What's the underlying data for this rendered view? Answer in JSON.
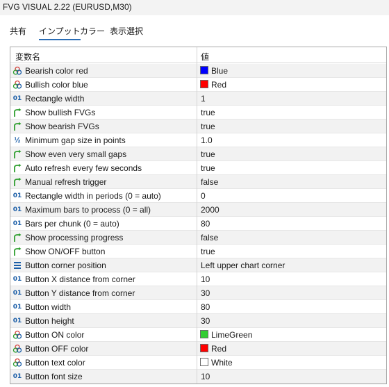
{
  "window": {
    "title": "FVG VISUAL 2.22 (EURUSD,M30)"
  },
  "tabs": [
    {
      "label": "共有",
      "active": false
    },
    {
      "label": "インプット",
      "active": true
    },
    {
      "label": "カラー",
      "active": false
    },
    {
      "label": "表示選択",
      "active": false
    }
  ],
  "table": {
    "header": {
      "name": "変数名",
      "value": "値"
    },
    "rows": [
      {
        "icon": "color-icon",
        "name": "Bearish color red",
        "value": "Blue",
        "swatch": "#0000ff"
      },
      {
        "icon": "color-icon",
        "name": "Bullish color blue",
        "value": "Red",
        "swatch": "#ff0000"
      },
      {
        "icon": "integer-icon",
        "name": "Rectangle width",
        "value": "1"
      },
      {
        "icon": "bool-arrow-icon",
        "name": "Show bullish FVGs",
        "value": "true"
      },
      {
        "icon": "bool-arrow-icon",
        "name": "Show bearish FVGs",
        "value": "true"
      },
      {
        "icon": "double-icon",
        "name": "Minimum gap size in points",
        "value": "1.0"
      },
      {
        "icon": "bool-arrow-icon",
        "name": "Show even very small gaps",
        "value": "true"
      },
      {
        "icon": "bool-arrow-icon",
        "name": "Auto refresh every few seconds",
        "value": "true"
      },
      {
        "icon": "bool-arrow-icon",
        "name": "Manual refresh trigger",
        "value": "false"
      },
      {
        "icon": "integer-icon",
        "name": "Rectangle width in periods (0 = auto)",
        "value": "0"
      },
      {
        "icon": "integer-icon",
        "name": "Maximum bars to process (0 = all)",
        "value": "2000"
      },
      {
        "icon": "integer-icon",
        "name": "Bars per chunk (0 = auto)",
        "value": "80"
      },
      {
        "icon": "bool-arrow-icon",
        "name": "Show processing progress",
        "value": "false"
      },
      {
        "icon": "bool-arrow-icon",
        "name": "Show ON/OFF button",
        "value": "true"
      },
      {
        "icon": "enum-icon",
        "name": "Button corner position",
        "value": "Left upper chart corner"
      },
      {
        "icon": "integer-icon",
        "name": "Button X distance from corner",
        "value": "10"
      },
      {
        "icon": "integer-icon",
        "name": "Button Y distance from corner",
        "value": "30"
      },
      {
        "icon": "integer-icon",
        "name": "Button width",
        "value": "80"
      },
      {
        "icon": "integer-icon",
        "name": "Button height",
        "value": "30"
      },
      {
        "icon": "color-icon",
        "name": "Button ON color",
        "value": "LimeGreen",
        "swatch": "#32cd32"
      },
      {
        "icon": "color-icon",
        "name": "Button OFF color",
        "value": "Red",
        "swatch": "#ff0000"
      },
      {
        "icon": "color-icon",
        "name": "Button text color",
        "value": "White",
        "swatch": "#ffffff"
      },
      {
        "icon": "integer-icon",
        "name": "Button font size",
        "value": "10"
      }
    ]
  },
  "colors": {
    "accent": "#2a6db5",
    "bool_icon": "#2e9e2e",
    "int_icon": "#1c5fa8"
  }
}
